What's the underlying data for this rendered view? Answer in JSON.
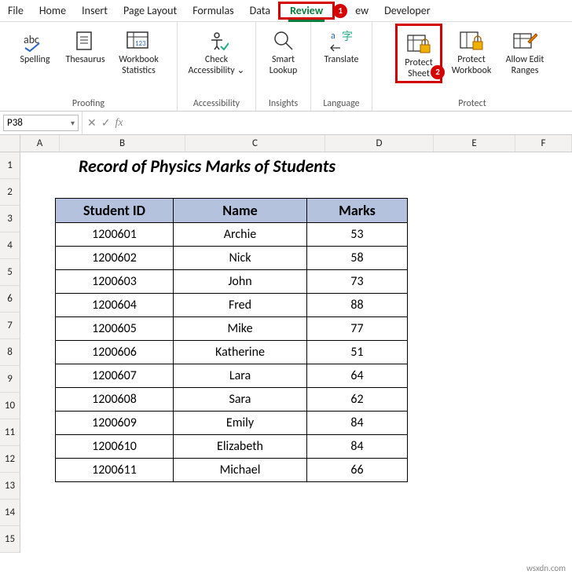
{
  "menu": {
    "file": "File",
    "home": "Home",
    "insert": "Insert",
    "page_layout": "Page Layout",
    "formulas": "Formulas",
    "data": "Data",
    "review": "Review",
    "view_partial": "ew",
    "developer": "Developer"
  },
  "badges": {
    "one": "1",
    "two": "2"
  },
  "ribbon": {
    "spelling": "Spelling",
    "thesaurus": "Thesaurus",
    "workbook_stats_l1": "Workbook",
    "workbook_stats_l2": "Statistics",
    "check_acc_l1": "Check",
    "check_acc_l2": "Accessibility ⌄",
    "smart_l1": "Smart",
    "smart_l2": "Lookup",
    "translate": "Translate",
    "protect_sheet_l1": "Protect",
    "protect_sheet_l2": "Sheet",
    "protect_wb_l1": "Protect",
    "protect_wb_l2": "Workbook",
    "allow_edit_l1": "Allow Edit",
    "allow_edit_l2": "Ranges",
    "group_proofing": "Proofing",
    "group_accessibility": "Accessibility",
    "group_insights": "Insights",
    "group_language": "Language",
    "group_protect": "Protect"
  },
  "namebox": "P38",
  "formula": "",
  "columns": {
    "A": "A",
    "B": "B",
    "C": "C",
    "D": "D",
    "E": "E",
    "F": "F"
  },
  "col_widths": {
    "A": 50,
    "B": 160,
    "C": 178,
    "D": 138,
    "E": 104,
    "F": 72
  },
  "rows": [
    "1",
    "2",
    "3",
    "4",
    "5",
    "6",
    "7",
    "8",
    "9",
    "10",
    "11",
    "12",
    "13",
    "14",
    "15"
  ],
  "sheet_title": "Record of Physics Marks of Students",
  "table": {
    "headers": {
      "id": "Student ID",
      "name": "Name",
      "marks": "Marks"
    },
    "rows": [
      {
        "id": "1200601",
        "name": "Archie",
        "marks": "53"
      },
      {
        "id": "1200602",
        "name": "Nick",
        "marks": "58"
      },
      {
        "id": "1200603",
        "name": "John",
        "marks": "73"
      },
      {
        "id": "1200604",
        "name": "Fred",
        "marks": "88"
      },
      {
        "id": "1200605",
        "name": "Mike",
        "marks": "77"
      },
      {
        "id": "1200606",
        "name": "Katherine",
        "marks": "51"
      },
      {
        "id": "1200607",
        "name": "Lara",
        "marks": "64"
      },
      {
        "id": "1200608",
        "name": "Sara",
        "marks": "62"
      },
      {
        "id": "1200609",
        "name": "Emily",
        "marks": "84"
      },
      {
        "id": "1200610",
        "name": "Elizabeth",
        "marks": "84"
      },
      {
        "id": "1200611",
        "name": "Michael",
        "marks": "66"
      }
    ]
  },
  "watermark": "wsxdn.com"
}
